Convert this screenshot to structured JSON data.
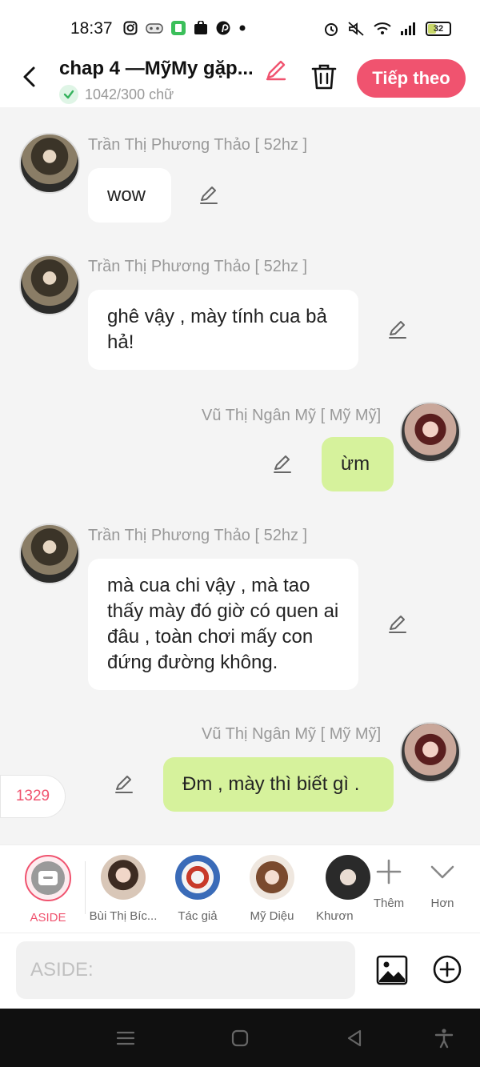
{
  "status_bar": {
    "time": "18:37",
    "battery": "32"
  },
  "header": {
    "title": "chap 4 —MỹMy gặp...",
    "word_count": "1042/300 chữ",
    "next_label": "Tiếp theo"
  },
  "messages": [
    {
      "sender": "Trần Thị Phương Thảo [ 52hz ]",
      "text": "wow",
      "side": "left"
    },
    {
      "sender": "Trần Thị Phương Thảo [ 52hz ]",
      "text": "ghê vậy , mày tính cua bả hả!",
      "side": "left"
    },
    {
      "sender": "Vũ Thị Ngân Mỹ [ Mỹ Mỹ]",
      "text": "ừm",
      "side": "right"
    },
    {
      "sender": "Trần Thị Phương Thảo [ 52hz ]",
      "text": "mà cua chi vậy , mà tao thấy mày đó giờ có quen ai đâu , toàn chơi mấy con đứng đường không.",
      "side": "left"
    },
    {
      "sender": "Vũ Thị Ngân Mỹ [ Mỹ Mỹ]",
      "text": "Đm , mày thì biết gì .",
      "side": "right"
    }
  ],
  "counter_badge": "1329",
  "characters": [
    {
      "label": "ASIDE"
    },
    {
      "label": "Bùi Thị Bíc..."
    },
    {
      "label": "Tác giả"
    },
    {
      "label": "Mỹ Diệu"
    },
    {
      "label": "Khươn"
    }
  ],
  "more_actions": {
    "add_label": "Thêm",
    "more_label": "Hơn"
  },
  "composer": {
    "placeholder": "ASIDE:"
  },
  "colors": {
    "accent": "#f0536f",
    "bubble_right": "#d6f29c",
    "bubble_left": "#ffffff",
    "background": "#f4f4f4"
  }
}
